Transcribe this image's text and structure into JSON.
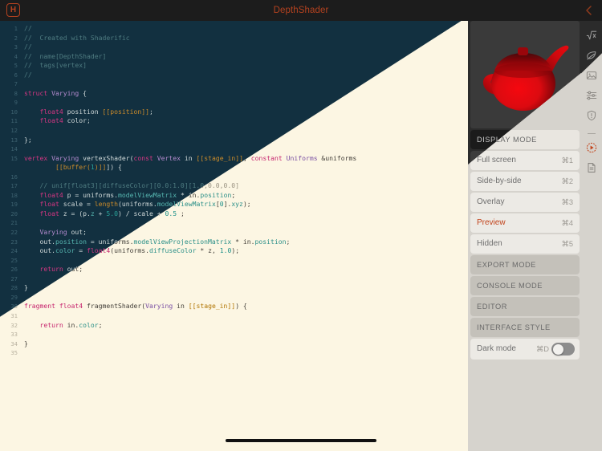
{
  "titlebar": {
    "app_badge": "H",
    "title": "DepthShader",
    "back_icon": "chevron-left-icon",
    "accent_color": "#b5421f"
  },
  "editor": {
    "language": "metal",
    "theme_dark_bg": "#123040",
    "theme_light_bg": "#fcf6e3",
    "first_line": 1,
    "last_line": 35,
    "lines": [
      {
        "n": 1,
        "t": [
          [
            "cmt",
            "//"
          ]
        ]
      },
      {
        "n": 2,
        "t": [
          [
            "cmt",
            "//  Created with Shaderific"
          ]
        ]
      },
      {
        "n": 3,
        "t": [
          [
            "cmt",
            "//"
          ]
        ]
      },
      {
        "n": 4,
        "t": [
          [
            "cmt",
            "//  name[DepthShader]"
          ]
        ]
      },
      {
        "n": 5,
        "t": [
          [
            "cmt",
            "//  tags[vertex]"
          ]
        ]
      },
      {
        "n": 6,
        "t": [
          [
            "cmt",
            "//"
          ]
        ]
      },
      {
        "n": 7,
        "t": []
      },
      {
        "n": 8,
        "t": [
          [
            "kw",
            "struct"
          ],
          [
            "pun",
            " "
          ],
          [
            "typ",
            "Varying"
          ],
          [
            "pun",
            " {"
          ]
        ]
      },
      {
        "n": 9,
        "t": []
      },
      {
        "n": 10,
        "t": [
          [
            "pun",
            "    "
          ],
          [
            "kw",
            "float4"
          ],
          [
            "pun",
            " position "
          ],
          [
            "attr",
            "[[position]]"
          ],
          [
            "pun",
            ";"
          ]
        ]
      },
      {
        "n": 11,
        "t": [
          [
            "pun",
            "    "
          ],
          [
            "kw",
            "float4"
          ],
          [
            "pun",
            " color;"
          ]
        ]
      },
      {
        "n": 12,
        "t": []
      },
      {
        "n": 13,
        "t": [
          [
            "pun",
            "};"
          ]
        ]
      },
      {
        "n": 14,
        "t": []
      },
      {
        "n": 15,
        "t": [
          [
            "kw",
            "vertex"
          ],
          [
            "pun",
            " "
          ],
          [
            "typ",
            "Varying"
          ],
          [
            "pun",
            " vertexShader("
          ],
          [
            "kw",
            "const"
          ],
          [
            "pun",
            " "
          ],
          [
            "typ",
            "Vertex"
          ],
          [
            "pun",
            " in "
          ],
          [
            "attr",
            "[[stage_in]]"
          ],
          [
            "pun",
            ", "
          ],
          [
            "kw",
            "constant"
          ],
          [
            "pun",
            " "
          ],
          [
            "typ",
            "Uniforms"
          ],
          [
            "pun",
            " &uniforms"
          ]
        ]
      },
      {
        "n": "",
        "t": [
          [
            "pun",
            "        "
          ],
          [
            "attr",
            "[[buffer("
          ],
          [
            "num",
            "1"
          ],
          [
            "attr",
            ")]]"
          ],
          [
            "pun",
            "]) {"
          ]
        ]
      },
      {
        "n": 16,
        "t": []
      },
      {
        "n": 17,
        "t": [
          [
            "pun",
            "    "
          ],
          [
            "cmt",
            "// unif[float3][diffuseColor][0.0:1.0][1.0,0.0,0.0]"
          ]
        ]
      },
      {
        "n": 18,
        "t": [
          [
            "pun",
            "    "
          ],
          [
            "kw",
            "float4"
          ],
          [
            "pun",
            " p = uniforms."
          ],
          [
            "mem",
            "modelViewMatrix"
          ],
          [
            "pun",
            " * in."
          ],
          [
            "mem",
            "position"
          ],
          [
            "pun",
            ";"
          ]
        ]
      },
      {
        "n": 19,
        "t": [
          [
            "pun",
            "    "
          ],
          [
            "kw",
            "float"
          ],
          [
            "pun",
            " scale = "
          ],
          [
            "bi",
            "length"
          ],
          [
            "pun",
            "(uniforms."
          ],
          [
            "mem",
            "modelViewMatrix"
          ],
          [
            "pun",
            "["
          ],
          [
            "num",
            "0"
          ],
          [
            "pun",
            "]."
          ],
          [
            "mem",
            "xyz"
          ],
          [
            "pun",
            ");"
          ]
        ]
      },
      {
        "n": 20,
        "t": [
          [
            "pun",
            "    "
          ],
          [
            "kw",
            "float"
          ],
          [
            "pun",
            " z = (p."
          ],
          [
            "mem",
            "z"
          ],
          [
            "pun",
            " + "
          ],
          [
            "num",
            "5.0"
          ],
          [
            "pun",
            ") / scale + "
          ],
          [
            "num",
            "0.5"
          ],
          [
            "pun",
            " ;"
          ]
        ]
      },
      {
        "n": 21,
        "t": []
      },
      {
        "n": 22,
        "t": [
          [
            "pun",
            "    "
          ],
          [
            "typ",
            "Varying"
          ],
          [
            "pun",
            " out;"
          ]
        ]
      },
      {
        "n": 23,
        "t": [
          [
            "pun",
            "    out."
          ],
          [
            "mem",
            "position"
          ],
          [
            "pun",
            " = uniforms."
          ],
          [
            "mem",
            "modelViewProjectionMatrix"
          ],
          [
            "pun",
            " * in."
          ],
          [
            "mem",
            "position"
          ],
          [
            "pun",
            ";"
          ]
        ]
      },
      {
        "n": 24,
        "t": [
          [
            "pun",
            "    out."
          ],
          [
            "mem",
            "color"
          ],
          [
            "pun",
            " = "
          ],
          [
            "kw",
            "float4"
          ],
          [
            "pun",
            "(uniforms."
          ],
          [
            "mem",
            "diffuseColor"
          ],
          [
            "pun",
            " * z, "
          ],
          [
            "num",
            "1.0"
          ],
          [
            "pun",
            ");"
          ]
        ]
      },
      {
        "n": 25,
        "t": []
      },
      {
        "n": 26,
        "t": [
          [
            "pun",
            "    "
          ],
          [
            "kw",
            "return"
          ],
          [
            "pun",
            " out;"
          ]
        ]
      },
      {
        "n": 27,
        "t": []
      },
      {
        "n": 28,
        "t": [
          [
            "pun",
            "}"
          ]
        ]
      },
      {
        "n": 29,
        "t": []
      },
      {
        "n": 30,
        "t": [
          [
            "kw",
            "fragment"
          ],
          [
            "pun",
            " "
          ],
          [
            "kw",
            "float4"
          ],
          [
            "pun",
            " fragmentShader("
          ],
          [
            "typ",
            "Varying"
          ],
          [
            "pun",
            " in "
          ],
          [
            "attr",
            "[[stage_in]]"
          ],
          [
            "pun",
            ") {"
          ]
        ]
      },
      {
        "n": 31,
        "t": []
      },
      {
        "n": 32,
        "t": [
          [
            "pun",
            "    "
          ],
          [
            "kw",
            "return"
          ],
          [
            "pun",
            " in."
          ],
          [
            "mem",
            "color"
          ],
          [
            "pun",
            ";"
          ]
        ]
      },
      {
        "n": 33,
        "t": []
      },
      {
        "n": 34,
        "t": [
          [
            "pun",
            "}"
          ]
        ]
      },
      {
        "n": 35,
        "t": []
      }
    ]
  },
  "preview": {
    "object": "teapot",
    "object_color": "#e00c12",
    "background": "#3a3a3a"
  },
  "sidebar": {
    "display_mode_header": "DISPLAY MODE",
    "display_modes": [
      {
        "label": "Full screen",
        "key": "⌘1",
        "active": false
      },
      {
        "label": "Side-by-side",
        "key": "⌘2",
        "active": false
      },
      {
        "label": "Overlay",
        "key": "⌘3",
        "active": false
      },
      {
        "label": "Preview",
        "key": "⌘4",
        "active": true
      },
      {
        "label": "Hidden",
        "key": "⌘5",
        "active": false
      }
    ],
    "sections": [
      {
        "label": "EXPORT MODE"
      },
      {
        "label": "CONSOLE MODE"
      },
      {
        "label": "EDITOR"
      },
      {
        "label": "INTERFACE STYLE"
      }
    ],
    "dark_mode": {
      "label": "Dark mode",
      "key": "⌘D",
      "on": false
    },
    "active_color": "#c2441c"
  },
  "rail": {
    "icons": [
      {
        "name": "sqrt-icon",
        "accent": false
      },
      {
        "name": "leaf-icon",
        "accent": false
      },
      {
        "name": "image-icon",
        "accent": false
      },
      {
        "name": "sliders-icon",
        "accent": false
      },
      {
        "name": "shield-icon",
        "accent": false
      },
      {
        "name": "play-circle-icon",
        "accent": true
      },
      {
        "name": "document-icon",
        "accent": false
      }
    ]
  }
}
